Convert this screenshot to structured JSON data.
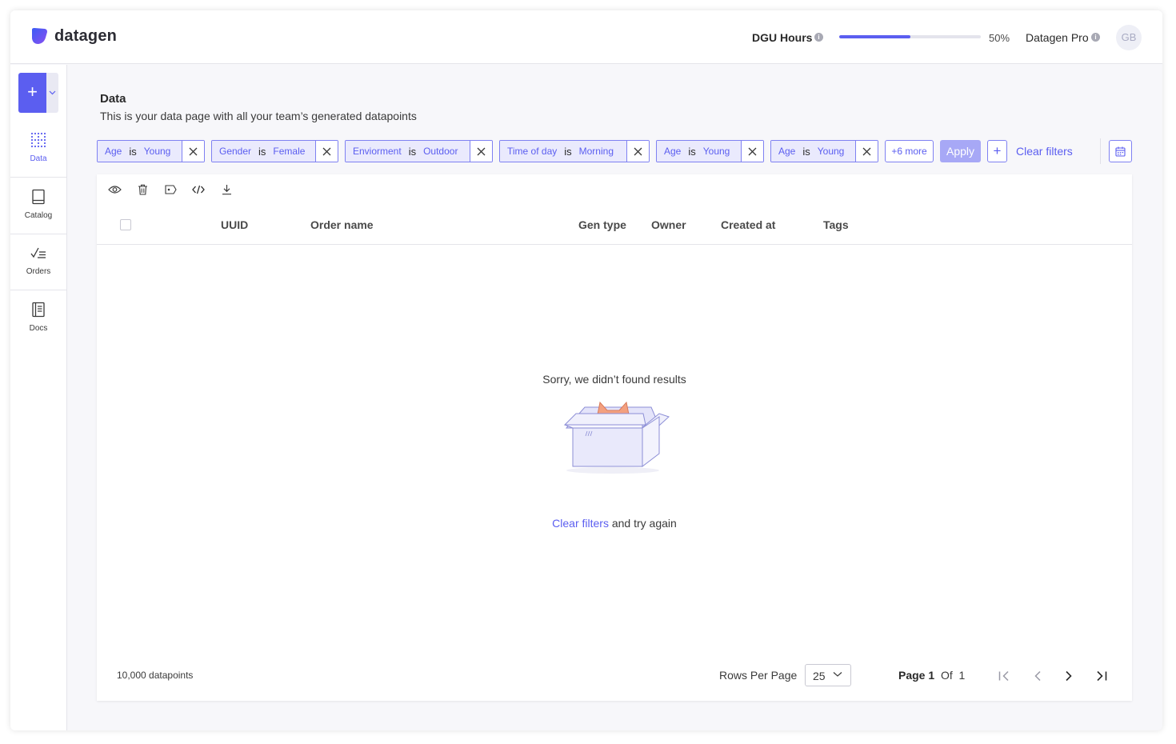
{
  "app": {
    "name": "datagen",
    "brand_color": "#5b5ef0"
  },
  "topbar": {
    "usage_label": "DGU Hours",
    "usage_fraction": 0.5,
    "usage_percent_text": "50%",
    "plan_label": "Datagen Pro",
    "avatar_initials": "GB"
  },
  "sidebar": {
    "create_label": "+",
    "items": [
      {
        "label": "Data",
        "icon": "grid-dots-icon",
        "active": true
      },
      {
        "label": "Catalog",
        "icon": "book-icon",
        "active": false
      },
      {
        "label": "Orders",
        "icon": "checklist-icon",
        "active": false
      },
      {
        "label": "Docs",
        "icon": "document-icon",
        "active": false
      }
    ]
  },
  "page": {
    "title": "Data",
    "subtitle": "This is your data page with all your team’s generated datapoints"
  },
  "filters": {
    "chips": [
      {
        "field": "Age",
        "op": "is",
        "value": "Young"
      },
      {
        "field": "Gender",
        "op": "is",
        "value": "Female"
      },
      {
        "field": "Enviorment",
        "op": "is",
        "value": "Outdoor"
      },
      {
        "field": "Time of day",
        "op": "is",
        "value": "Morning"
      },
      {
        "field": "Age",
        "op": "is",
        "value": "Young"
      },
      {
        "field": "Age",
        "op": "is",
        "value": "Young"
      }
    ],
    "more_label": "+6 more",
    "apply_label": "Apply",
    "add_label": "+",
    "clear_label": "Clear filters"
  },
  "table": {
    "toolbar_icons": [
      "eye-icon",
      "trash-icon",
      "tag-icon",
      "code-icon",
      "download-icon"
    ],
    "columns": [
      "UUID",
      "Order name",
      "Gen type",
      "Owner",
      "Created at",
      "Tags"
    ],
    "empty_message": "Sorry, we didn’t found results",
    "retry_link": "Clear filters",
    "retry_text": " and try again"
  },
  "footer": {
    "count": "10,000 datapoints",
    "rows_per_page_label": "Rows Per Page",
    "rows_per_page": "25",
    "page_word": "Page",
    "page_current": "1",
    "of_word": "Of",
    "page_total": "1"
  }
}
